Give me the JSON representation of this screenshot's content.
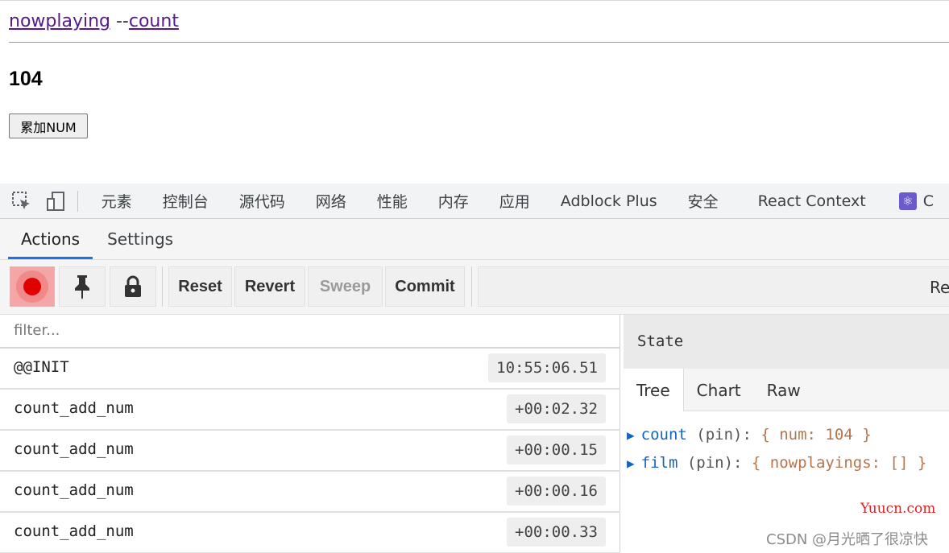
{
  "app": {
    "nav_link_1": "nowplaying",
    "nav_sep": " --",
    "nav_link_2": "count",
    "count_value": "104",
    "add_button": "累加NUM"
  },
  "devtools": {
    "tabs": [
      "元素",
      "控制台",
      "源代码",
      "网络",
      "性能",
      "内存",
      "应用",
      "Adblock Plus",
      "安全",
      "React Context",
      "C"
    ]
  },
  "redux": {
    "subtabs": [
      "Actions",
      "Settings"
    ],
    "toolbar": {
      "reset": "Reset",
      "revert": "Revert",
      "sweep": "Sweep",
      "commit": "Commit",
      "right_cut": "Rea"
    },
    "filter_placeholder": "filter...",
    "actions": [
      {
        "name": "@@INIT",
        "time": "10:55:06.51"
      },
      {
        "name": "count_add_num",
        "time": "+00:02.32"
      },
      {
        "name": "count_add_num",
        "time": "+00:00.15"
      },
      {
        "name": "count_add_num",
        "time": "+00:00.16"
      },
      {
        "name": "count_add_num",
        "time": "+00:00.33"
      }
    ],
    "state": {
      "title": "State",
      "tabs": [
        "Tree",
        "Chart",
        "Raw"
      ],
      "tree": [
        {
          "key": "count",
          "pin": " (pin):",
          "value": " { num: 104 }"
        },
        {
          "key": "film",
          "pin": " (pin):",
          "value": " { nowplayings: [] }"
        }
      ]
    }
  },
  "watermarks": {
    "site": "Yuucn.com",
    "author": "CSDN @月光晒了很凉快"
  },
  "colors": {
    "link": "#551a8b",
    "record": "#e00000",
    "active_tab": "#1a73e8",
    "tree_key": "#1565c0",
    "tree_value": "#b5764d"
  }
}
